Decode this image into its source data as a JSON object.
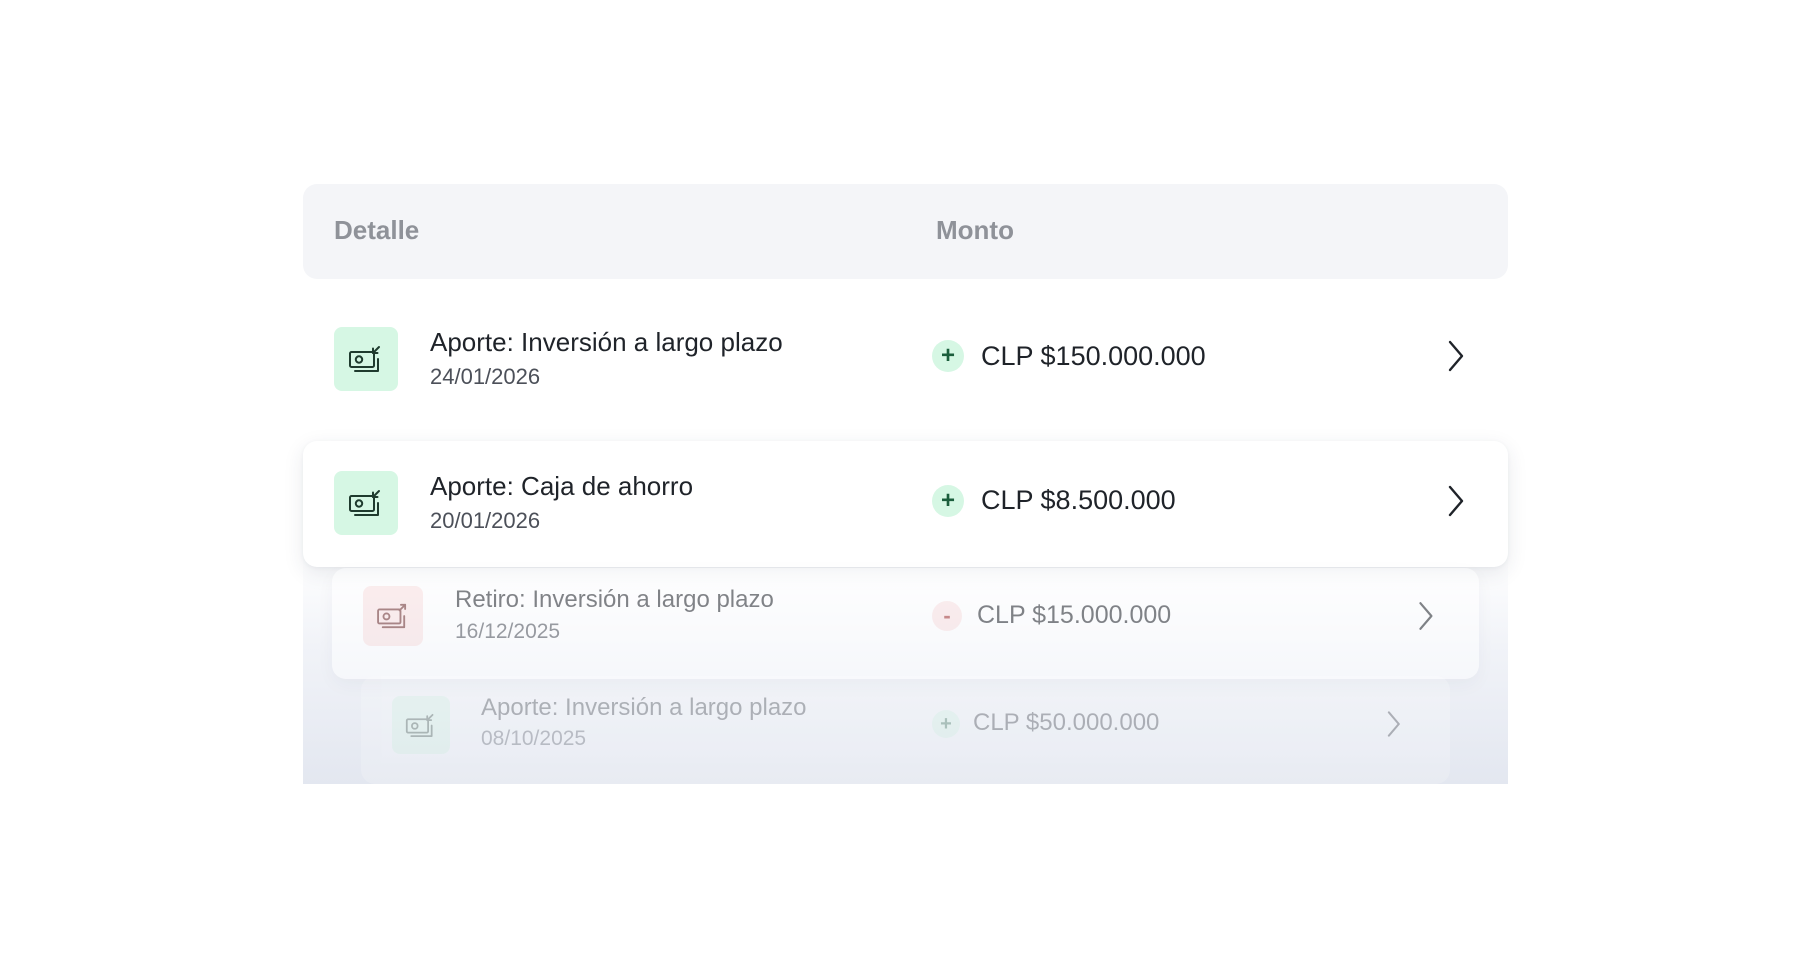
{
  "table": {
    "headers": {
      "detail": "Detalle",
      "amount": "Monto"
    },
    "rows": [
      {
        "type": "in",
        "icon": "money-in-icon",
        "title": "Aporte: Inversión a largo plazo",
        "date": "24/01/2026",
        "sign": "+",
        "amount": "CLP $150.000.000"
      },
      {
        "type": "in",
        "icon": "money-in-icon",
        "title": "Aporte: Caja de ahorro",
        "date": "20/01/2026",
        "sign": "+",
        "amount": "CLP $8.500.000"
      },
      {
        "type": "out",
        "icon": "money-out-icon",
        "title": "Retiro: Inversión a largo plazo",
        "date": "16/12/2025",
        "sign": "-",
        "amount": "CLP $15.000.000"
      },
      {
        "type": "in",
        "icon": "money-in-icon",
        "title": "Aporte: Inversión a largo plazo",
        "date": "08/10/2025",
        "sign": "+",
        "amount": "CLP $50.000.000"
      }
    ]
  },
  "colors": {
    "in_bg": "#d6f7e4",
    "in_fg": "#1b5e3c",
    "out_bg": "#fbe2e2",
    "out_fg": "#a03030",
    "header_bg": "#f4f5f8"
  }
}
